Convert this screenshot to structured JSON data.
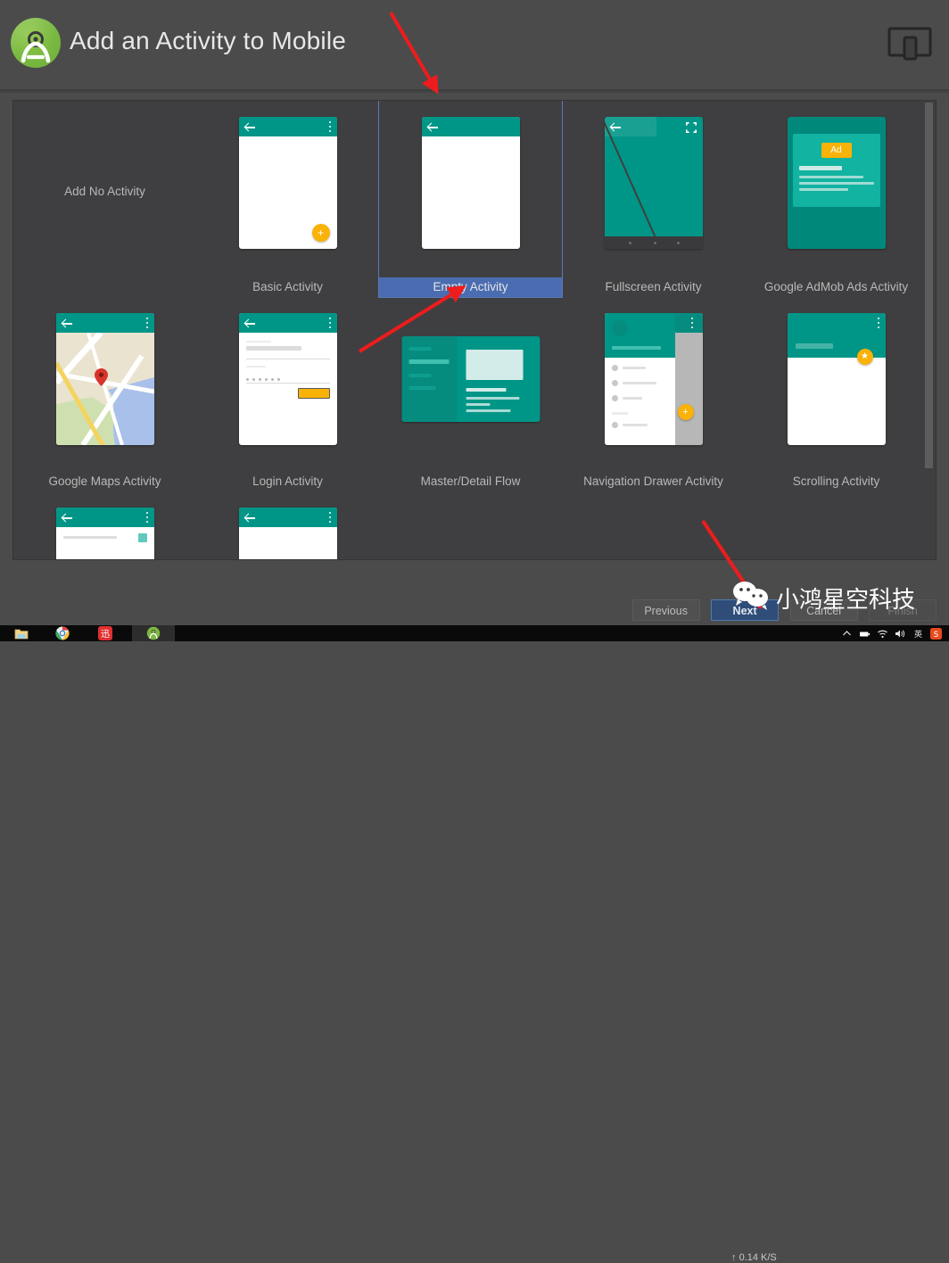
{
  "window": {
    "title": "Add an Activity to Mobile",
    "logo_icon": "android-studio-logo",
    "device_icon": "mobile-device-icon"
  },
  "gallery": {
    "rows": [
      {
        "cells": [
          {
            "label": "Add No Activity",
            "thumb": "none",
            "selected": false
          },
          {
            "label": "Basic Activity",
            "thumb": "basic",
            "selected": false
          },
          {
            "label": "Empty Activity",
            "thumb": "empty",
            "selected": true
          },
          {
            "label": "Fullscreen Activity",
            "thumb": "fullscreen",
            "selected": false
          },
          {
            "label": "Google AdMob Ads Activity",
            "thumb": "admob",
            "selected": false
          }
        ]
      },
      {
        "cells": [
          {
            "label": "Google Maps Activity",
            "thumb": "maps",
            "selected": false
          },
          {
            "label": "Login Activity",
            "thumb": "login",
            "selected": false
          },
          {
            "label": "Master/Detail Flow",
            "thumb": "master",
            "selected": false
          },
          {
            "label": "Navigation Drawer Activity",
            "thumb": "navdrawer",
            "selected": false
          },
          {
            "label": "Scrolling Activity",
            "thumb": "scrolling",
            "selected": false
          }
        ]
      },
      {
        "cells": [
          {
            "label": "",
            "thumb": "settings",
            "selected": false
          },
          {
            "label": "",
            "thumb": "tabbed",
            "selected": false
          }
        ]
      }
    ],
    "admob_badge": "Ad"
  },
  "footer": {
    "buttons": [
      {
        "label": "Previous",
        "state": "enabled"
      },
      {
        "label": "Next",
        "state": "primary"
      },
      {
        "label": "Cancel",
        "state": "enabled"
      },
      {
        "label": "Finish",
        "state": "disabled"
      }
    ]
  },
  "watermark": {
    "text": "小鸿星空科技",
    "icon": "wechat-icon"
  },
  "taskbar": {
    "icons": [
      "folder-icon",
      "chrome-icon",
      "red-app-icon",
      "android-studio-icon"
    ],
    "network_speed": "0.14 K/S",
    "tray_icons": [
      "chevron-up-icon",
      "battery-icon",
      "wifi-icon",
      "volume-icon",
      "ime-icon",
      "snipaste-icon"
    ]
  },
  "colors": {
    "accent_teal": "#009687",
    "accent_amber": "#f9b208",
    "selection_blue": "#4a6cb0",
    "background": "#4b4b4b",
    "panel": "#3f3f41",
    "annotation_red": "#ee1c1c"
  }
}
